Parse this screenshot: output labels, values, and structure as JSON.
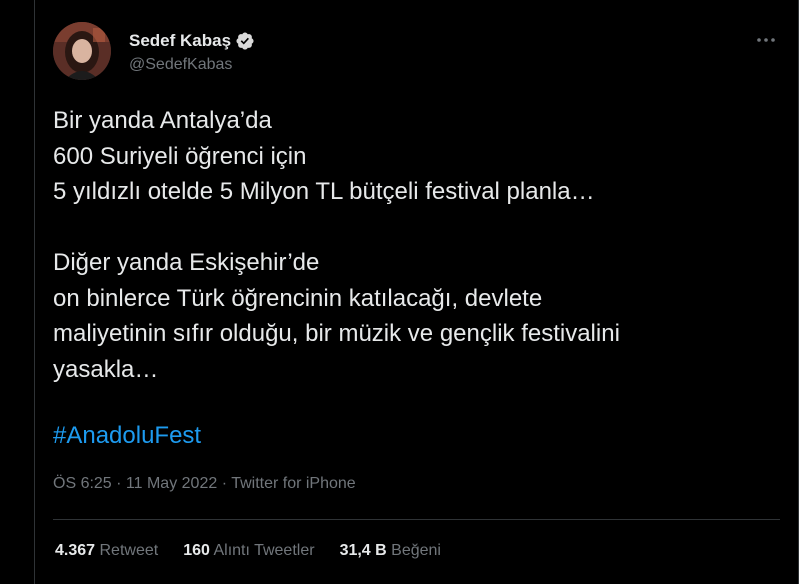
{
  "author": {
    "display_name": "Sedef Kabaş",
    "handle": "@SedefKabas",
    "verified": true,
    "verified_color": "#d9d9d9"
  },
  "tweet": {
    "lines": [
      "Bir yanda Antalya’da",
      "600 Suriyeli öğrenci için",
      "5 yıldızlı otelde 5 Milyon TL bütçeli festival planla…",
      "",
      "Diğer yanda Eskişehir’de",
      "on binlerce Türk öğrencinin katılacağı, devlete",
      "maliyetinin sıfır olduğu, bir müzik ve gençlik festivalini",
      "yasakla…"
    ],
    "hashtag": "#AnadoluFest",
    "hashtag_color": "#1d9bf0"
  },
  "meta": {
    "time": "ÖS 6:25",
    "separator": " · ",
    "date": "11 May 2022",
    "source": "Twitter for iPhone"
  },
  "stats": {
    "retweets_count": "4.367",
    "retweets_label": "Retweet",
    "quotes_count": "160",
    "quotes_label": "Alıntı Tweetler",
    "likes_count": "31,4 B",
    "likes_label": "Beğeni"
  },
  "icons": {
    "more": "more-horizontal-icon",
    "verified": "verified-badge-icon"
  }
}
